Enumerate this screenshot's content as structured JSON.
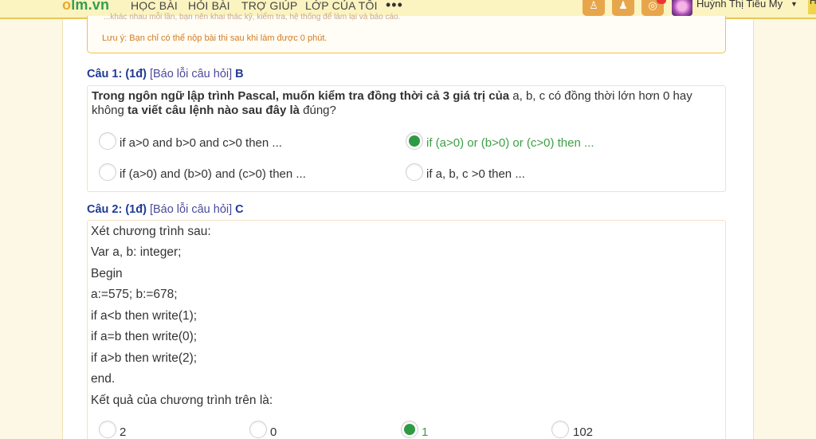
{
  "nav": {
    "logo_o": "o",
    "logo_rest": "lm.vn",
    "items": [
      "HỌC BÀI",
      "HỎI BÀI",
      "TRỢ GIÚP",
      "LỚP CỦA TÔI"
    ],
    "more": "•••",
    "user_name": "Huỳnh Thị Tiểu My",
    "edge_label": "H"
  },
  "notice": {
    "cut_line": "...khác nhau mỗi lần, bạn nên khai thác kỹ, kiểm tra, hệ thống để làm lại và báo cáo.",
    "text": "Lưu ý: Bạn chỉ có thể nộp bài thi sau khi làm được 0 phút."
  },
  "q1": {
    "number": "Câu 1: (1đ)",
    "report": "[Báo lỗi câu hỏi]",
    "answer": "B",
    "prompt_bold": "Trong ngôn ngữ lập trình Pascal, muốn kiểm tra đồng thời cả 3 giá trị của",
    "prompt_mid": " a, b, c có đồng thời lớn hơn 0 hay không ",
    "prompt_bold2": "ta viết câu lệnh nào sau đây là",
    "prompt_end": " đúng?",
    "options": [
      "if a>0 and b>0 and c>0 then ...",
      "if (a>0) or (b>0) or (c>0) then ...",
      "if (a>0) and (b>0) and (c>0) then ...",
      "if a, b, c >0 then ..."
    ]
  },
  "q2": {
    "number": "Câu 2: (1đ)",
    "report": "[Báo lỗi câu hỏi]",
    "answer": "C",
    "lines": [
      "Xét chương trình sau:",
      "Var a, b: integer;",
      "Begin",
      "a:=575; b:=678;",
      "if a<b then write(1);",
      "if a=b then write(0);",
      "if a>b then write(2);",
      "end.",
      "Kết quả của chương trình trên là:"
    ],
    "options": [
      "2",
      "0",
      "1",
      "102"
    ]
  },
  "colors": {
    "accent_green": "#2f9a44",
    "question_blue": "#1f3a93",
    "notice_orange": "#d27b25",
    "topbar": "#fbf3c0"
  }
}
